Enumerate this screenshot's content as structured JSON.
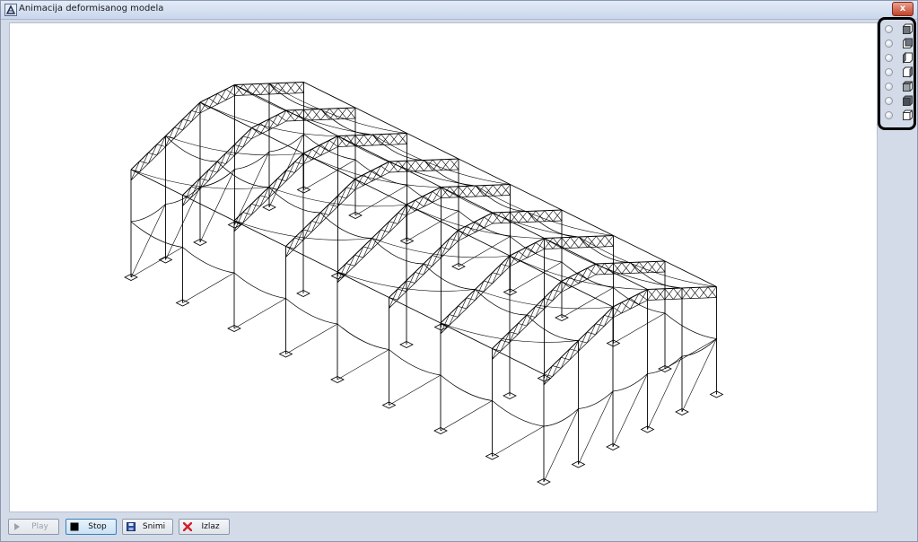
{
  "window": {
    "title": "Animacija deformisanog modela",
    "close_symbol": "x"
  },
  "viewbar": {
    "items": [
      {
        "icon": "view-front-icon",
        "selected": false
      },
      {
        "icon": "view-back-icon",
        "selected": false
      },
      {
        "icon": "view-left-icon",
        "selected": false
      },
      {
        "icon": "view-right-icon",
        "selected": false
      },
      {
        "icon": "view-top-icon",
        "selected": false
      },
      {
        "icon": "view-bottom-icon",
        "selected": false
      },
      {
        "icon": "view-iso-icon",
        "selected": false
      }
    ]
  },
  "toolbar": {
    "play_label": "Play",
    "stop_label": "Stop",
    "save_label": "Snimi",
    "exit_label": "Izlaz"
  },
  "colors": {
    "window_bg": "#d4dbe8",
    "canvas_bg": "#ffffff",
    "wire": "#000000",
    "exit_icon": "#d0202a",
    "save_icon": "#2b4fa0"
  }
}
